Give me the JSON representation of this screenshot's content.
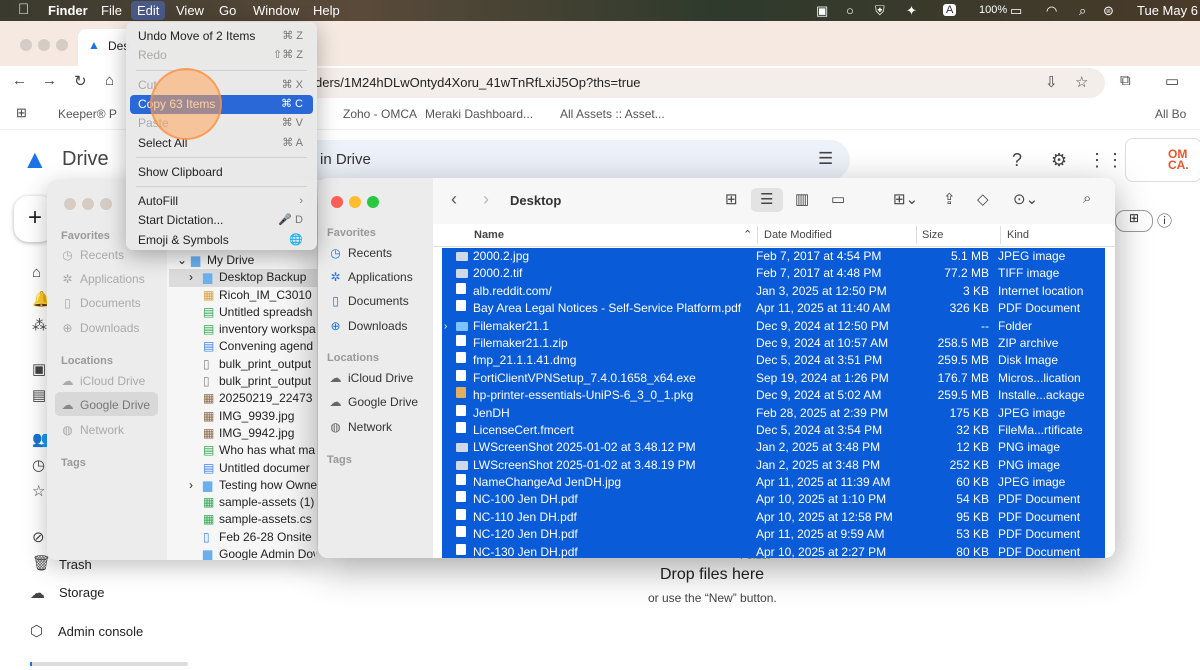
{
  "menubar": {
    "apple": "",
    "items": [
      "Finder",
      "File",
      "Edit",
      "View",
      "Go",
      "Window",
      "Help"
    ],
    "battery": "100%",
    "clock": "Tue May 6",
    "input_source": "A"
  },
  "browser": {
    "tab_title": "Des",
    "url": "ders/1M24hDLwOntyd4Xoru_41wTnRfLxiJ5Op?ths=true",
    "bookmarks": [
      "Keeper® P",
      "Zoho - OMCA",
      "Meraki Dashboard...",
      "All Assets :: Asset..."
    ],
    "all_bookmarks": "All Bo"
  },
  "drive": {
    "logo": "Drive",
    "search_placeholder": "in Drive",
    "left_nav": [
      "Trash",
      "Storage",
      "Admin console"
    ],
    "drop_title": "Drop files here",
    "drop_sub": "or use the “New” button.",
    "org_badge": "OM CA.",
    "partial_folder": "Folder"
  },
  "edit_menu": {
    "items": [
      {
        "label": "Undo Move of 2 Items",
        "shortcut": "⌘ Z",
        "disabled": false
      },
      {
        "label": "Redo",
        "shortcut": "⇧⌘ Z",
        "disabled": true
      },
      {
        "sep": true
      },
      {
        "label": "Cut",
        "shortcut": "⌘ X",
        "disabled": true
      },
      {
        "label": "Copy 63 Items",
        "shortcut": "⌘ C",
        "disabled": false,
        "highlight": true
      },
      {
        "label": "Paste",
        "shortcut": "⌘ V",
        "disabled": true
      },
      {
        "label": "Select All",
        "shortcut": "⌘ A",
        "disabled": false
      },
      {
        "sep": true
      },
      {
        "label": "Show Clipboard",
        "shortcut": "",
        "disabled": false
      },
      {
        "sep": true
      },
      {
        "label": "AutoFill",
        "shortcut": "›",
        "disabled": false
      },
      {
        "label": "Start Dictation...",
        "shortcut": "🎤 D",
        "disabled": false
      },
      {
        "label": "Emoji & Symbols",
        "shortcut": "🌐",
        "disabled": false
      }
    ]
  },
  "finder_back": {
    "favorites_header": "Favorites",
    "favorites": [
      "Recents",
      "Applications",
      "Documents",
      "Downloads"
    ],
    "locations_header": "Locations",
    "locations": [
      "iCloud Drive",
      "Google Drive",
      "Network"
    ],
    "tags_header": "Tags",
    "tree_root": "My Drive",
    "items": [
      "Desktop Backup",
      "Ricoh_IM_C3010",
      "Untitled spreadsh",
      "inventory workspa",
      "Convening agend",
      "bulk_print_output",
      "bulk_print_output",
      "20250219_22473",
      "IMG_9939.jpg",
      "IMG_9942.jpg",
      "Who has what ma",
      "Untitled documer",
      "Testing how Owne",
      "sample-assets (1)",
      "sample-assets.cs",
      "Feb 26-28 Onsite",
      "Google Admin Downloads"
    ]
  },
  "finder": {
    "title": "Desktop",
    "favorites_header": "Favorites",
    "favorites": [
      "Recents",
      "Applications",
      "Documents",
      "Downloads"
    ],
    "locations_header": "Locations",
    "locations": [
      "iCloud Drive",
      "Google Drive",
      "Network"
    ],
    "tags_header": "Tags",
    "columns": {
      "name": "Name",
      "date": "Date Modified",
      "size": "Size",
      "kind": "Kind"
    },
    "files": [
      {
        "name": "2000.2.jpg",
        "date": "Feb 7, 2017 at 4:54 PM",
        "size": "5.1 MB",
        "kind": "JPEG image",
        "icon": "image"
      },
      {
        "name": "2000.2.tif",
        "date": "Feb 7, 2017 at 4:48 PM",
        "size": "77.2 MB",
        "kind": "TIFF image",
        "icon": "image"
      },
      {
        "name": "alb.reddit.com/",
        "date": "Jan 3, 2025 at 12:50 PM",
        "size": "3 KB",
        "kind": "Internet location",
        "icon": "web"
      },
      {
        "name": "Bay Area Legal Notices - Self-Service Platform.pdf",
        "date": "Apr 11, 2025 at 11:40 AM",
        "size": "326 KB",
        "kind": "PDF Document",
        "icon": "doc"
      },
      {
        "name": "Filemaker21.1",
        "date": "Dec 9, 2024 at 12:50 PM",
        "size": "--",
        "kind": "Folder",
        "icon": "folder"
      },
      {
        "name": "Filemaker21.1.zip",
        "date": "Dec 9, 2024 at 10:57 AM",
        "size": "258.5 MB",
        "kind": "ZIP archive",
        "icon": "zip"
      },
      {
        "name": "fmp_21.1.1.41.dmg",
        "date": "Dec 5, 2024 at 3:51 PM",
        "size": "259.5 MB",
        "kind": "Disk Image",
        "icon": "doc"
      },
      {
        "name": "FortiClientVPNSetup_7.4.0.1658_x64.exe",
        "date": "Sep 19, 2024 at 1:26 PM",
        "size": "176.7 MB",
        "kind": "Micros...lication",
        "icon": "doc"
      },
      {
        "name": "hp-printer-essentials-UniPS-6_3_0_1.pkg",
        "date": "Dec 9, 2024 at 5:02 AM",
        "size": "259.5 MB",
        "kind": "Installe...ackage",
        "icon": "pkg"
      },
      {
        "name": "JenDH",
        "date": "Feb 28, 2025 at 2:39 PM",
        "size": "175 KB",
        "kind": "JPEG image",
        "icon": "doc"
      },
      {
        "name": "LicenseCert.fmcert",
        "date": "Dec 5, 2024 at 3:54 PM",
        "size": "32 KB",
        "kind": "FileMa...rtificate",
        "icon": "doc"
      },
      {
        "name": "LWScreenShot 2025-01-02 at 3.48.12 PM",
        "date": "Jan 2, 2025 at 3:48 PM",
        "size": "12 KB",
        "kind": "PNG image",
        "icon": "shot"
      },
      {
        "name": "LWScreenShot 2025-01-02 at 3.48.19 PM",
        "date": "Jan 2, 2025 at 3:48 PM",
        "size": "252 KB",
        "kind": "PNG image",
        "icon": "shot"
      },
      {
        "name": "NameChangeAd JenDH.jpg",
        "date": "Apr 11, 2025 at 11:39 AM",
        "size": "60 KB",
        "kind": "JPEG image",
        "icon": "doc"
      },
      {
        "name": "NC-100 Jen DH.pdf",
        "date": "Apr 10, 2025 at 1:10 PM",
        "size": "54 KB",
        "kind": "PDF Document",
        "icon": "doc"
      },
      {
        "name": "NC-110 Jen DH.pdf",
        "date": "Apr 10, 2025 at 12:58 PM",
        "size": "95 KB",
        "kind": "PDF Document",
        "icon": "doc"
      },
      {
        "name": "NC-120 Jen DH.pdf",
        "date": "Apr 11, 2025 at 9:59 AM",
        "size": "53 KB",
        "kind": "PDF Document",
        "icon": "doc"
      },
      {
        "name": "NC-130 Jen DH.pdf",
        "date": "Apr 10, 2025 at 2:27 PM",
        "size": "80 KB",
        "kind": "PDF Document",
        "icon": "doc"
      }
    ]
  },
  "colors": {
    "selection": "#0a5bd8",
    "menu_highlight": "#2a68d8",
    "drive_blue": "#1a73e8"
  }
}
